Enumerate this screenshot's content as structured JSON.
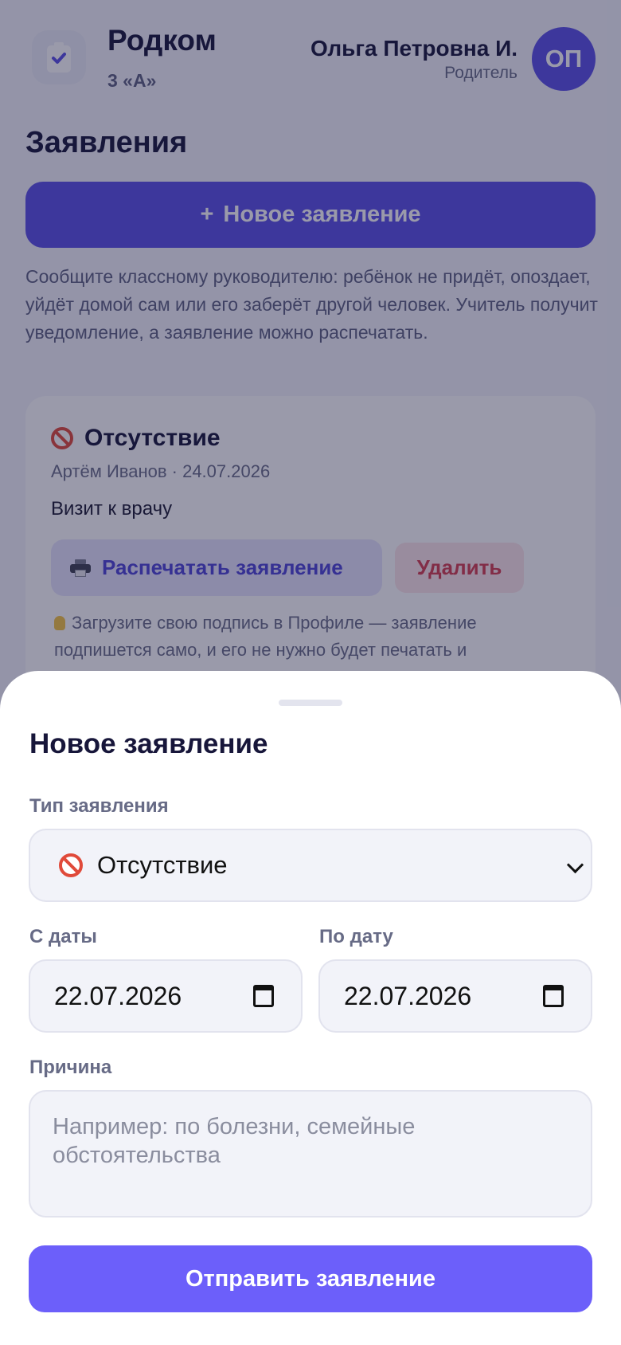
{
  "header": {
    "app_title": "Родком",
    "class_name": "3 «А»",
    "user_name": "Ольга Петровна И.",
    "user_role": "Родитель",
    "avatar_initials": "ОП"
  },
  "page": {
    "title": "Заявления",
    "new_button_label": "Новое заявление",
    "new_button_icon": "+",
    "intro": "Сообщите классному руководителю: ребёнок не придёт, опоздает, уйдёт домой сам или его заберёт другой человек. Учитель получит уведомление, а заявление можно распечатать."
  },
  "application_card": {
    "type": "Отсутствие",
    "meta": "Артём Иванов · 24.07.2026",
    "reason": "Визит к врачу",
    "print_label": "Распечатать заявление",
    "delete_label": "Удалить",
    "hint": "Загрузите свою подпись в Профиле — заявление подпишется само, и его не нужно будет печатать и"
  },
  "sheet": {
    "title": "Новое заявление",
    "type_label": "Тип заявления",
    "type_value": "Отсутствие",
    "from_label": "С даты",
    "from_value": "22.07.2026",
    "to_label": "По дату",
    "to_value": "22.07.2026",
    "reason_label": "Причина",
    "reason_placeholder": "Например: по болезни, семейные обстоятельства",
    "submit_label": "Отправить заявление"
  },
  "colors": {
    "accent": "#5a4fe6",
    "submit": "#6c5ffa",
    "danger": "#d43d4f",
    "overlay": "rgba(24,24,62,0.44)"
  }
}
